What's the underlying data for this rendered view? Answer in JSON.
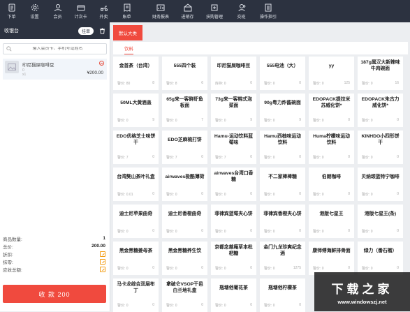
{
  "toolbar": [
    {
      "label": "下单",
      "icon": "order-icon"
    },
    {
      "label": "设置",
      "icon": "settings-icon"
    },
    {
      "label": "会员",
      "icon": "member-icon"
    },
    {
      "label": "计次卡",
      "icon": "card-icon"
    },
    {
      "label": "外卖",
      "icon": "delivery-icon"
    },
    {
      "label": "账单",
      "icon": "bill-icon"
    },
    {
      "label": "财务报表",
      "icon": "report-icon"
    },
    {
      "label": "进销存",
      "icon": "inventory-icon"
    },
    {
      "label": "扶购管理",
      "icon": "purchase-icon"
    },
    {
      "label": "交班",
      "icon": "shift-icon"
    },
    {
      "label": "操作指引",
      "icon": "guide-icon"
    }
  ],
  "cashier": {
    "title": "收银台",
    "pending_label": "挂单",
    "member_placeholder": "输入会员卡、手机号或姓名"
  },
  "cart": [
    {
      "name": "印尼猫屎咖啡豆",
      "sub": "0",
      "qty": "x1",
      "price": "¥200.00"
    }
  ],
  "summary": {
    "qty_label": "商品数量:",
    "qty_value": "1",
    "total_label": "总价:",
    "total_value": "200.00",
    "discount_label": "折扣:",
    "erase_label": "抹零:",
    "receivable_label": "应收总额:",
    "receivable_value": "200.00"
  },
  "pay_button": "收 款 200",
  "category_tab": "默认大类",
  "sub_tab": "饮料",
  "products": [
    {
      "name": "金首茶（台湾）",
      "stock_label": "警价: 80",
      "stock": "8"
    },
    {
      "name": "555四个装",
      "stock_label": "警价: 8",
      "stock": "6"
    },
    {
      "name": "印尼猫屎咖啡豆",
      "stock_label": "库存: 0",
      "stock": "0"
    },
    {
      "name": "555电池（大）",
      "stock_label": "警价: 0",
      "stock": "0"
    },
    {
      "name": "yy",
      "stock_label": "警价: 0",
      "stock": "125"
    },
    {
      "name": "187g属汉大新辣味牛肉碗面",
      "stock_label": "警价: 0",
      "stock": "16"
    },
    {
      "name": "50ML大黄酒盖",
      "stock_label": "警价: 0",
      "stock": "9"
    },
    {
      "name": "65g来一客鲜虾鱼板面",
      "stock_label": "警价: 0",
      "stock": "7"
    },
    {
      "name": "73g来一客韩式泡菜面",
      "stock_label": "警价: 0",
      "stock": "9"
    },
    {
      "name": "90g粤力炸酱碗面",
      "stock_label": "警价: 0",
      "stock": "9"
    },
    {
      "name": "EDOPACK提拉米苏威化饼*",
      "stock_label": "警价: 0",
      "stock": "0"
    },
    {
      "name": "EDOPACK朱古力威化饼*",
      "stock_label": "警价: 0",
      "stock": "0"
    },
    {
      "name": "EDO优格芝士味饼干",
      "stock_label": "警价: 7",
      "stock": "0"
    },
    {
      "name": "EDO芝麻梳打饼",
      "stock_label": "警价: 7",
      "stock": "0"
    },
    {
      "name": "Hamu-运动饮料蓝莓味",
      "stock_label": "警价: 7",
      "stock": "0"
    },
    {
      "name": "Hamu西柚味运动饮料",
      "stock_label": "警价: 0",
      "stock": "0"
    },
    {
      "name": "Huma柠檬味运动饮料",
      "stock_label": "警价: 0",
      "stock": "0"
    },
    {
      "name": "KINHDO小四形饼干",
      "stock_label": "警价: 0",
      "stock": "0"
    },
    {
      "name": "台湾獒山茶叶礼盒",
      "stock_label": "警价: 0.01",
      "stock": "0"
    },
    {
      "name": "airwaves极酷薄荷",
      "stock_label": "警价: 0",
      "stock": "0"
    },
    {
      "name": "airwaves台湾口香糖",
      "stock_label": "警价: 0",
      "stock": "0"
    },
    {
      "name": "不二家棒棒糖",
      "stock_label": "警价: 0",
      "stock": "0"
    },
    {
      "name": "伯朗咖啡",
      "stock_label": "警价: 0",
      "stock": "0"
    },
    {
      "name": "贝纳颂蓝特宁咖啡",
      "stock_label": "警价: 0",
      "stock": "0"
    },
    {
      "name": "迪士尼苹果曲奇",
      "stock_label": "警价: 0",
      "stock": "0"
    },
    {
      "name": "迪士尼香橙曲奇",
      "stock_label": "警价: 0",
      "stock": "0"
    },
    {
      "name": "菲律宾蓝莓夹心饼",
      "stock_label": "警价: 0",
      "stock": "0"
    },
    {
      "name": "菲律宾香橙夹心饼",
      "stock_label": "警价: 0",
      "stock": "0"
    },
    {
      "name": "港版七星王",
      "stock_label": "警价: 0",
      "stock": "0"
    },
    {
      "name": "港版七星王(条)",
      "stock_label": "警价: 0",
      "stock": "0"
    },
    {
      "name": "黑金黑糖姜母茶",
      "stock_label": "警价: 0",
      "stock": "0"
    },
    {
      "name": "黑金黑糖养生饮",
      "stock_label": "警价: 0",
      "stock": "0"
    },
    {
      "name": "京都念慈庵草本枇杷糖",
      "stock_label": "警价: 0",
      "stock": "0"
    },
    {
      "name": "金门九龙珍爽纪念酒",
      "stock_label": "警价: 0",
      "stock": "1275"
    },
    {
      "name": "康师傅海鲜排骨面",
      "stock_label": "警价: 0",
      "stock": "0"
    },
    {
      "name": "绿力（番石榴）",
      "stock_label": "警价: 0",
      "stock": "0"
    },
    {
      "name": "马卡龙综合双层布丁",
      "stock_label": "警价: 0",
      "stock": "0"
    },
    {
      "name": "拿破仑VSOP干邑白兰地礼盒",
      "stock_label": "警价: 0",
      "stock": "0"
    },
    {
      "name": "瓶塘他葡花茶",
      "stock_label": "警价: 0",
      "stock": "0"
    },
    {
      "name": "瓶塘他柠檬茶",
      "stock_label": "警价: 0",
      "stock": "0"
    }
  ],
  "watermark": {
    "title": "下载之家",
    "url": "www.windowszj.net"
  },
  "colors": {
    "accent": "#f04a3e",
    "topbar": "#2c3240"
  }
}
